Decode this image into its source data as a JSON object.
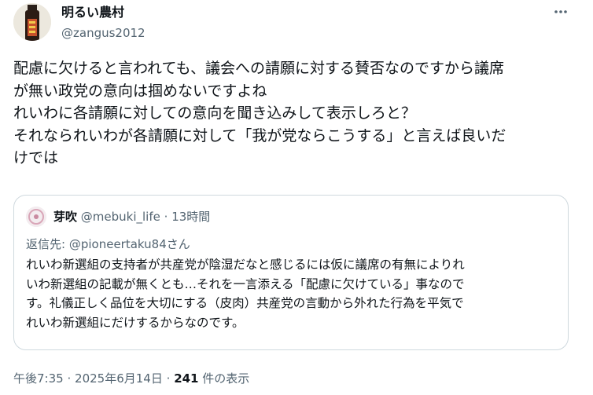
{
  "author": {
    "display_name": "明るい農村",
    "handle": "@zangus2012"
  },
  "more_icon": "more-horizontal-icon",
  "tweet": {
    "lines": [
      "配慮に欠けると言われても、議会への請願に対する賛否なのですから議席",
      "が無い政党の意向は掴めないですよね",
      "れいわに各請願に対しての意向を聞き込みして表示しろと？",
      "それなられいわが各請願に対して「我が党ならこうする」と言えば良いだ",
      "けでは"
    ]
  },
  "quoted": {
    "display_name": "芽吹",
    "handle": "@mebuki_life",
    "separator": "·",
    "time": "13時間",
    "reply_prefix": "返信先:",
    "reply_to": "@pioneertaku84さん",
    "lines": [
      "れいわ新選組の支持者が共産党が陰湿だなと感じるには仮に議席の有無によりれ",
      "いわ新選組の記載が無くとも…それを一言添える「配慮に欠けている」事なので",
      "す。礼儀正しく品位を大切にする（皮肉）共産党の言動から外れた行為を平気で",
      "れいわ新選組にだけするからなのです。"
    ]
  },
  "meta": {
    "time": "午後7:35",
    "separator": "·",
    "date": "2025年6月14日",
    "views_count": "241",
    "views_label": "件の表示"
  }
}
